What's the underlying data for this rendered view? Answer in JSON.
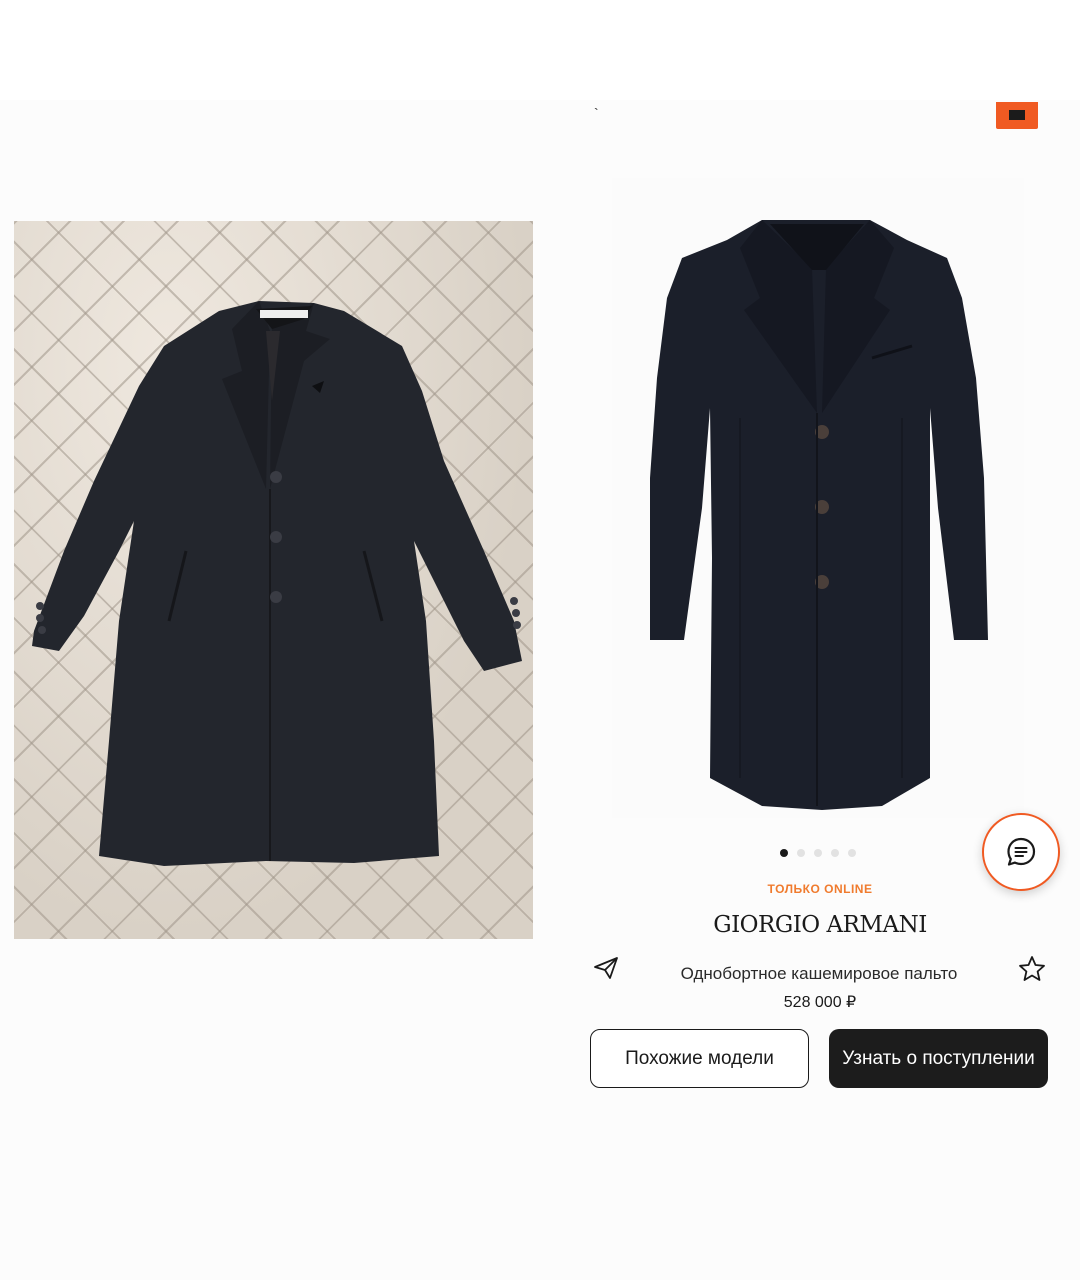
{
  "product": {
    "badge": "ТОЛЬКО ONLINE",
    "brand": "GIORGIO ARMANI",
    "name": "Однобортное кашемировое пальто",
    "price": "528 000 ₽"
  },
  "gallery": {
    "total_images": 5,
    "active_index": 0
  },
  "actions": {
    "similar_label": "Похожие модели",
    "notify_label": "Узнать о поступлении"
  },
  "icons": {
    "share": "paper-plane-icon",
    "favorite": "star-outline-icon",
    "chat": "chat-bubble-icon",
    "cart": "cart-icon"
  },
  "colors": {
    "accent": "#f05a22",
    "badge": "#f07b2e",
    "dark_button": "#1c1c1c"
  }
}
